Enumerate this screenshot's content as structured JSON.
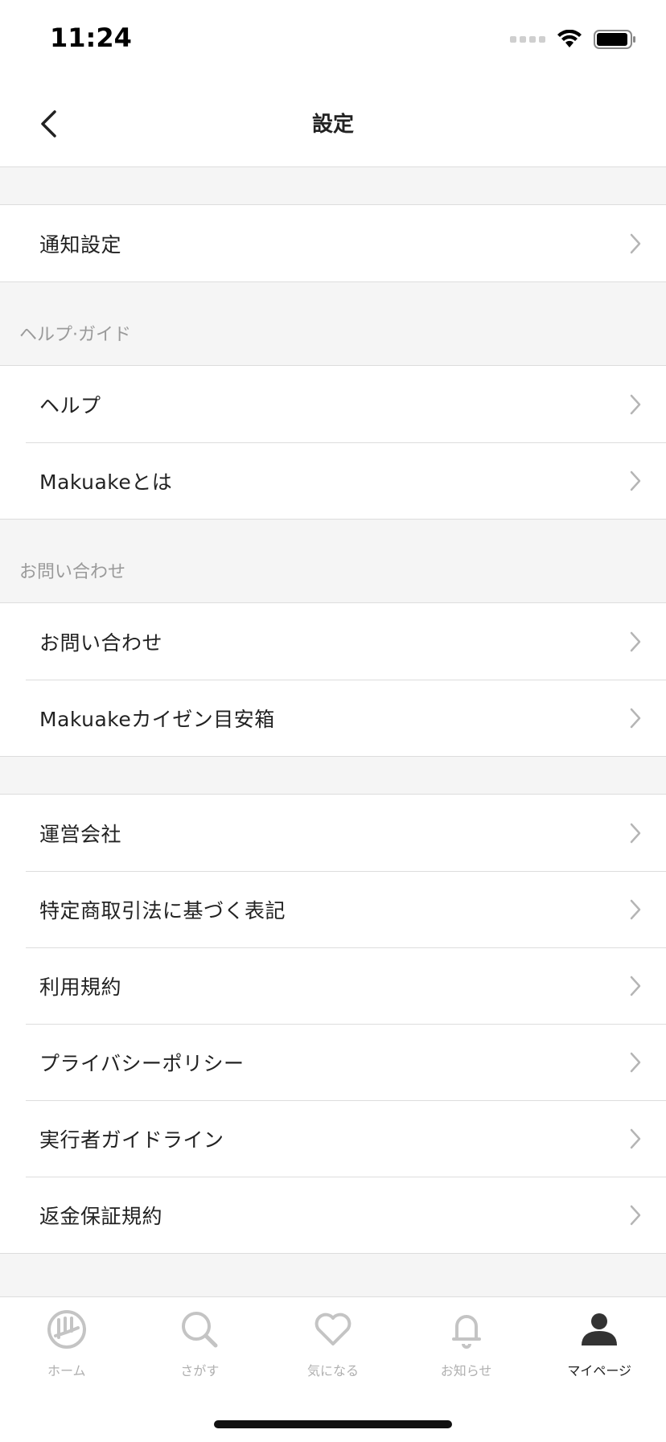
{
  "status": {
    "time": "11:24"
  },
  "nav": {
    "title": "設定",
    "back_icon": "chevron-left-icon"
  },
  "sections": [
    {
      "header": "",
      "rows": [
        "通知設定"
      ]
    },
    {
      "header": "ヘルプ·ガイド",
      "rows": [
        "ヘルプ",
        "Makuakeとは"
      ]
    },
    {
      "header": "お問い合わせ",
      "rows": [
        "お問い合わせ",
        "Makuakeカイゼン目安箱"
      ]
    },
    {
      "header": "",
      "rows": [
        "運営会社",
        "特定商取引法に基づく表記",
        "利用規約",
        "プライバシーポリシー",
        "実行者ガイドライン",
        "返金保証規約"
      ]
    }
  ],
  "tabbar": {
    "items": [
      {
        "label": "ホーム",
        "icon": "home-logo-icon"
      },
      {
        "label": "さがす",
        "icon": "search-icon"
      },
      {
        "label": "気になる",
        "icon": "heart-icon"
      },
      {
        "label": "お知らせ",
        "icon": "bell-icon"
      },
      {
        "label": "マイページ",
        "icon": "person-icon"
      }
    ],
    "active_index": 4
  },
  "colors": {
    "accent_active": "#222222",
    "inactive": "#b0b0b0",
    "background": "#f5f5f5"
  }
}
